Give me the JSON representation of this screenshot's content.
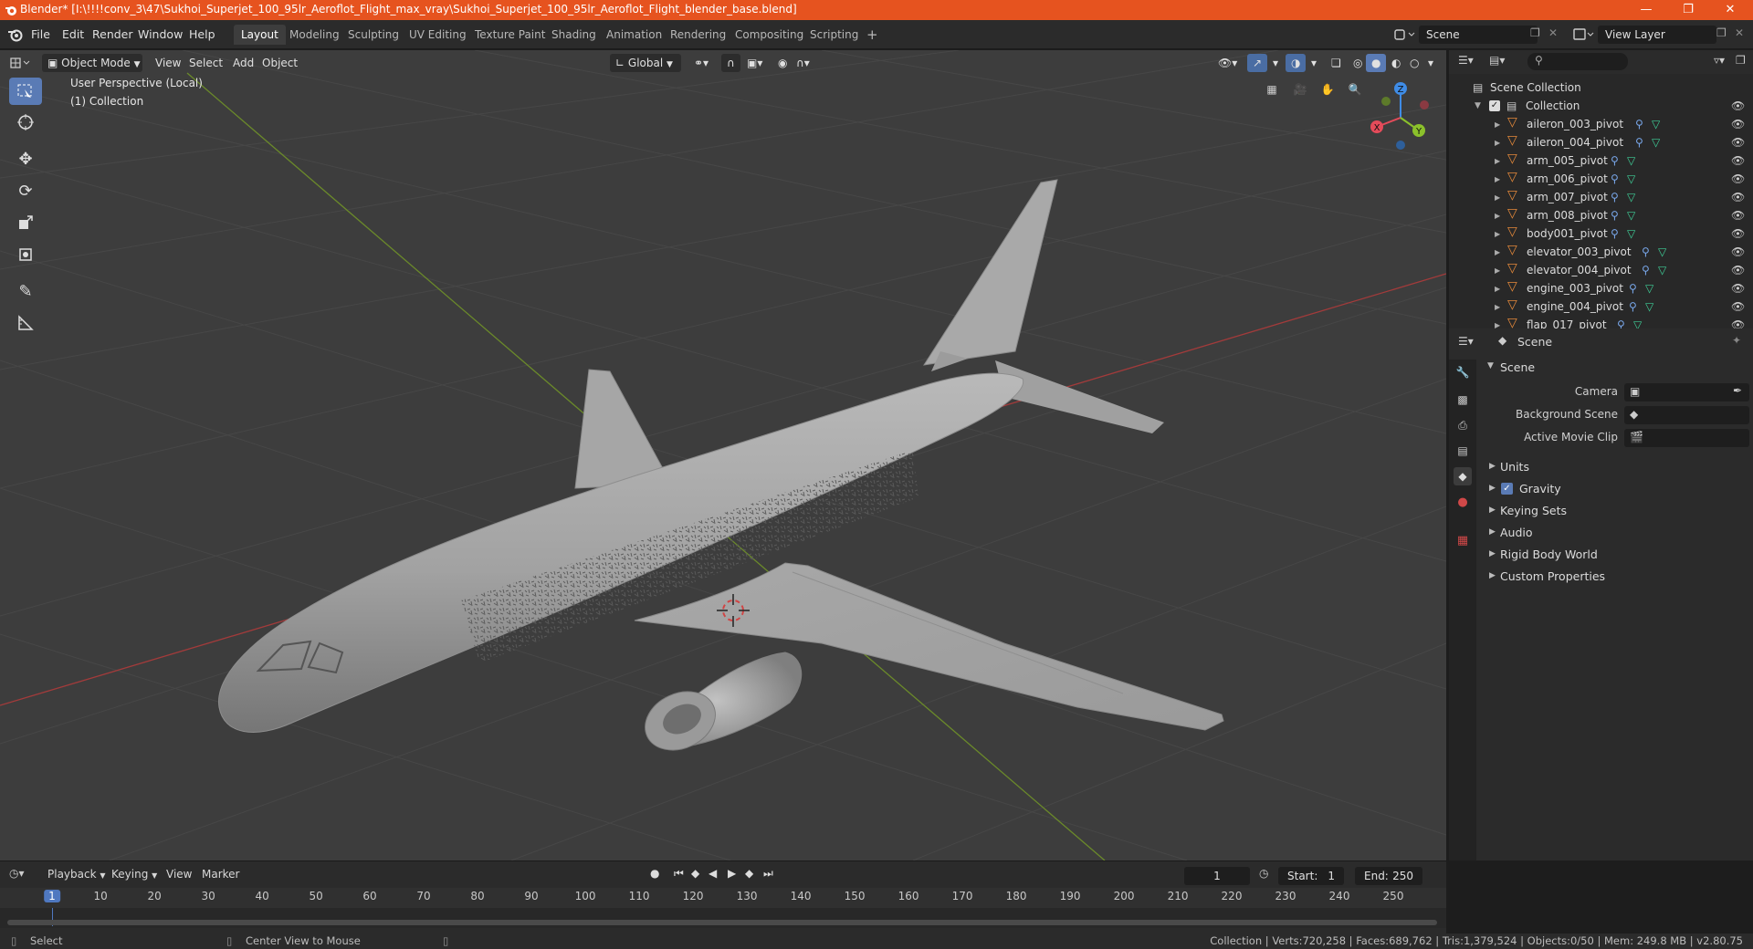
{
  "titlebar": {
    "title": "Blender* [I:\\!!!!conv_3\\47\\Sukhoi_Superjet_100_95lr_Aeroflot_Flight_max_vray\\Sukhoi_Superjet_100_95lr_Aeroflot_Flight_blender_base.blend]",
    "bg_color": "#e6531f"
  },
  "menubar": {
    "menus": [
      "File",
      "Edit",
      "Render",
      "Window",
      "Help"
    ],
    "workspaces": [
      "Layout",
      "Modeling",
      "Sculpting",
      "UV Editing",
      "Texture Paint",
      "Shading",
      "Animation",
      "Rendering",
      "Compositing",
      "Scripting"
    ],
    "active_workspace": "Layout",
    "add_workspace": "+",
    "scene_name": "Scene",
    "view_layer": "View Layer"
  },
  "viewport": {
    "mode": "Object Mode",
    "menus": [
      "View",
      "Select",
      "Add",
      "Object"
    ],
    "transform_orientation": "Global",
    "view_label": "User Perspective (Local)",
    "collection_label": "(1) Collection",
    "gizmo_axes": {
      "x": "X",
      "y": "Y",
      "z": "Z"
    },
    "axis_colors": {
      "x": "#e44b5a",
      "y": "#8bc12b",
      "z": "#3f8ce6"
    }
  },
  "outliner": {
    "root": "Scene Collection",
    "collection": "Collection",
    "items": [
      "aileron_003_pivot",
      "aileron_004_pivot",
      "arm_005_pivot",
      "arm_006_pivot",
      "arm_007_pivot",
      "arm_008_pivot",
      "body001_pivot",
      "elevator_003_pivot",
      "elevator_004_pivot",
      "engine_003_pivot",
      "engine_004_pivot",
      "flap_017_pivot"
    ]
  },
  "properties": {
    "context": "Scene",
    "panel_title": "Scene",
    "camera_label": "Camera",
    "background_scene_label": "Background Scene",
    "active_movie_clip_label": "Active Movie Clip",
    "sections": [
      "Units",
      "Gravity",
      "Keying Sets",
      "Audio",
      "Rigid Body World",
      "Custom Properties"
    ],
    "gravity_checked": true
  },
  "timeline": {
    "menus": [
      "Playback",
      "Keying",
      "View",
      "Marker"
    ],
    "current_frame": "1",
    "start_label": "Start:",
    "start": "1",
    "end_label": "End:",
    "end": "250",
    "ruler": [
      "1",
      "10",
      "20",
      "30",
      "40",
      "50",
      "60",
      "70",
      "80",
      "90",
      "100",
      "110",
      "120",
      "130",
      "140",
      "150",
      "160",
      "170",
      "180",
      "190",
      "200",
      "210",
      "220",
      "230",
      "240",
      "250"
    ]
  },
  "statusbar": {
    "left": "Select",
    "middle": "Center View to Mouse",
    "stats": "Collection | Verts:720,258 | Faces:689,762 | Tris:1,379,524 | Objects:0/50 | Mem: 249.8 MB | v2.80.75"
  }
}
